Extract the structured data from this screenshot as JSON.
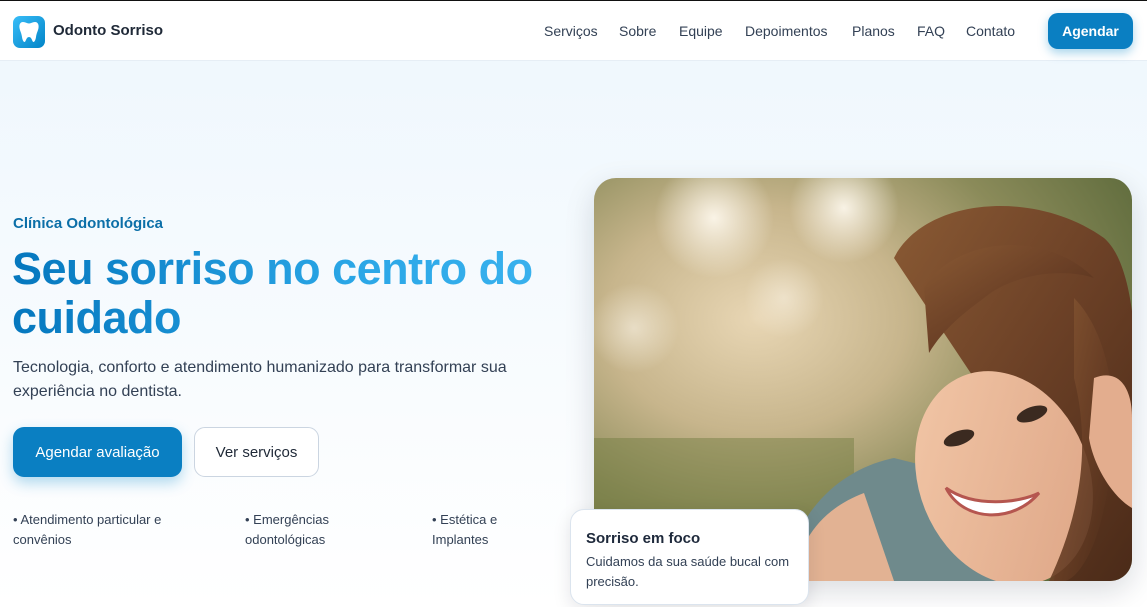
{
  "header": {
    "brand": "Odonto Sorriso",
    "logo_icon": "tooth-icon",
    "nav": [
      "Serviços",
      "Sobre",
      "Equipe",
      "Depoimentos",
      "Planos",
      "FAQ",
      "Contato"
    ],
    "cta": "Agendar"
  },
  "hero": {
    "eyebrow": "Clínica Odontológica",
    "title": "Seu sorriso no centro do cuidado",
    "subtitle": "Tecnologia, conforto e atendimento humanizado para transformar sua experiência no dentista.",
    "primary_button": "Agendar avaliação",
    "secondary_button": "Ver serviços",
    "features": [
      "• Atendimento particular e convênios",
      "• Emergências odontológicas",
      "• Estética e Implantes"
    ]
  },
  "card": {
    "title": "Sorriso em foco",
    "text": "Cuidamos da sua saúde bucal com precisão."
  },
  "colors": {
    "accent": "#0a7fc2",
    "eyebrow": "#0b6fa8",
    "title_gradient_start": "#0577be",
    "title_gradient_end": "#3bb3ef"
  }
}
